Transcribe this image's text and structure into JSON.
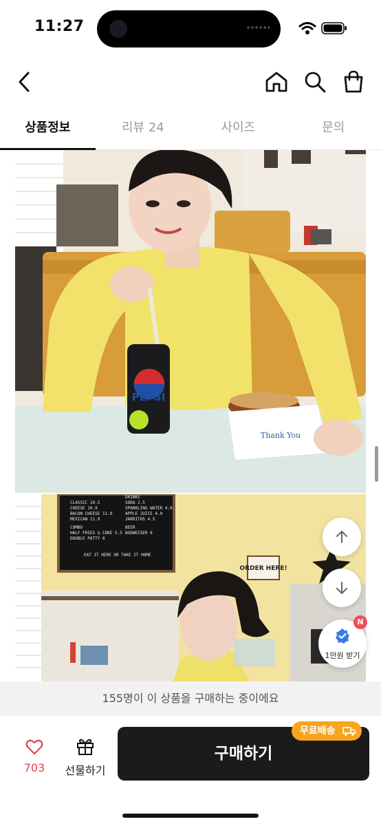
{
  "status": {
    "time": "11:27"
  },
  "tabs": [
    {
      "label": "상품정보",
      "active": true
    },
    {
      "label": "리뷰 24",
      "active": false
    },
    {
      "label": "사이즈",
      "active": false
    },
    {
      "label": "문의",
      "active": false
    }
  ],
  "content": {
    "photo1": {
      "can_text": "PEPSI",
      "wrapper_text": "Thank You"
    },
    "photo2": {
      "menu_board": {
        "lines": [
          "CLASSIC 10.5",
          "CHEESE 10.9",
          "BACON CHEESE 11.9",
          "MEXICAN 11.9",
          "COMBO",
          "HALF FRIES & COKE 5.5",
          "DOUBLE PATTY 6"
        ],
        "right_lines": [
          "DRINKS",
          "SODA 2.5",
          "SPARKLING WATER 4.0",
          "APPLE JUICE 4.0",
          "JARRITOS 4.5",
          "BEER",
          "BUDWEISER 6"
        ],
        "footer": "EAT IT HERE OR TAKE IT HOME"
      },
      "sign_text": "ORDER HERE!"
    }
  },
  "floating": {
    "coupon_badge": "N",
    "coupon_label": "1만원 받기"
  },
  "purchase_notice": "155명이 이 상품을 구매하는 중이에요",
  "bottom_bar": {
    "like_count": "703",
    "gift_label": "선물하기",
    "buy_label": "구매하기",
    "free_shipping": "무료배송"
  },
  "colors": {
    "accent_like": "#e04452",
    "buy_button": "#1b1b1b",
    "free_ship_badge": "#f7a51f",
    "coupon_badge": "#ef4d5a"
  },
  "icons": [
    "back-arrow-icon",
    "home-icon",
    "search-icon",
    "shopping-bag-icon",
    "arrow-up-icon",
    "arrow-down-icon",
    "verified-badge-icon",
    "heart-icon",
    "gift-icon",
    "truck-icon"
  ]
}
